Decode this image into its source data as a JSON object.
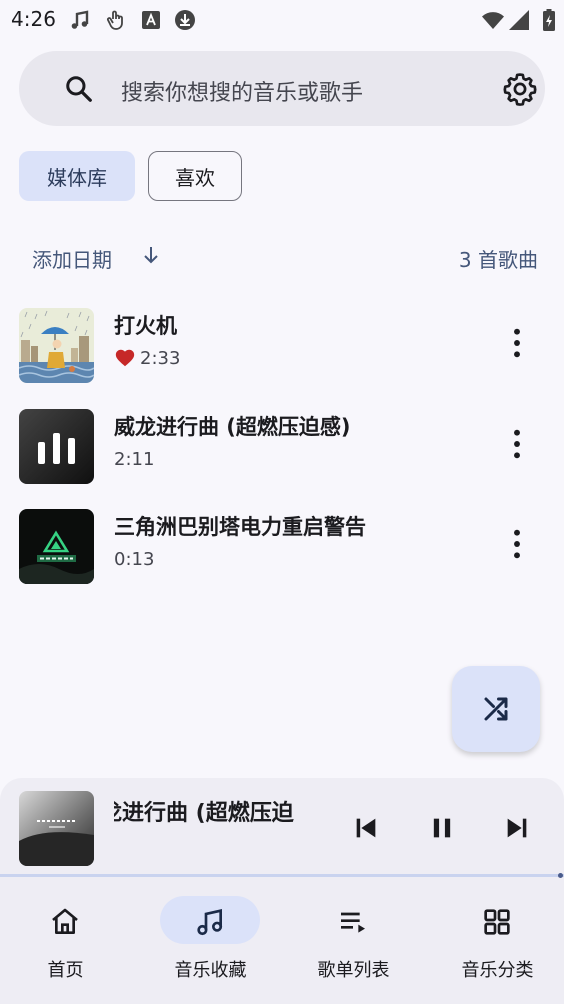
{
  "status_bar": {
    "time": "4:26",
    "left_icons": [
      "music-note-icon",
      "touch-icon",
      "app-a-icon",
      "download-icon"
    ],
    "right_icons": [
      "wifi-icon",
      "signal-icon",
      "battery-icon"
    ]
  },
  "search": {
    "placeholder": "搜索你想搜的音乐或歌手",
    "left_icon": "search-icon",
    "right_icon": "gear-icon"
  },
  "tabs": [
    {
      "label": "媒体库",
      "selected": true
    },
    {
      "label": "喜欢",
      "selected": false
    }
  ],
  "sort": {
    "label": "添加日期",
    "direction_icon": "arrow-down-icon",
    "count_label": "3 首歌曲"
  },
  "songs": [
    {
      "title": "打火机",
      "duration": "2:33",
      "favorited": true
    },
    {
      "title": "威龙进行曲 (超燃压迫感)",
      "duration": "2:11",
      "favorited": false,
      "playing": true
    },
    {
      "title": "三角洲巴别塔电力重启警告",
      "duration": "0:13",
      "favorited": false
    }
  ],
  "fab": {
    "icon": "shuffle-icon"
  },
  "now_playing": {
    "title": "威龙进行曲 (超燃压迫感)",
    "visible_title": "龙进行曲 (超燃压迫",
    "controls": [
      "skip-previous-icon",
      "pause-icon",
      "skip-next-icon"
    ],
    "progress": 0.99
  },
  "bottom_nav": [
    {
      "label": "首页",
      "icon": "home-icon",
      "active": false
    },
    {
      "label": "音乐收藏",
      "icon": "music-note-icon",
      "active": true
    },
    {
      "label": "歌单列表",
      "icon": "playlist-icon",
      "active": false
    },
    {
      "label": "音乐分类",
      "icon": "grid-icon",
      "active": false
    }
  ],
  "colors": {
    "background": "#f8f7fc",
    "accent_container": "#dbe2f9",
    "on_surface": "#1b1b1f",
    "secondary_text": "#45577a",
    "heart": "#c62828"
  }
}
